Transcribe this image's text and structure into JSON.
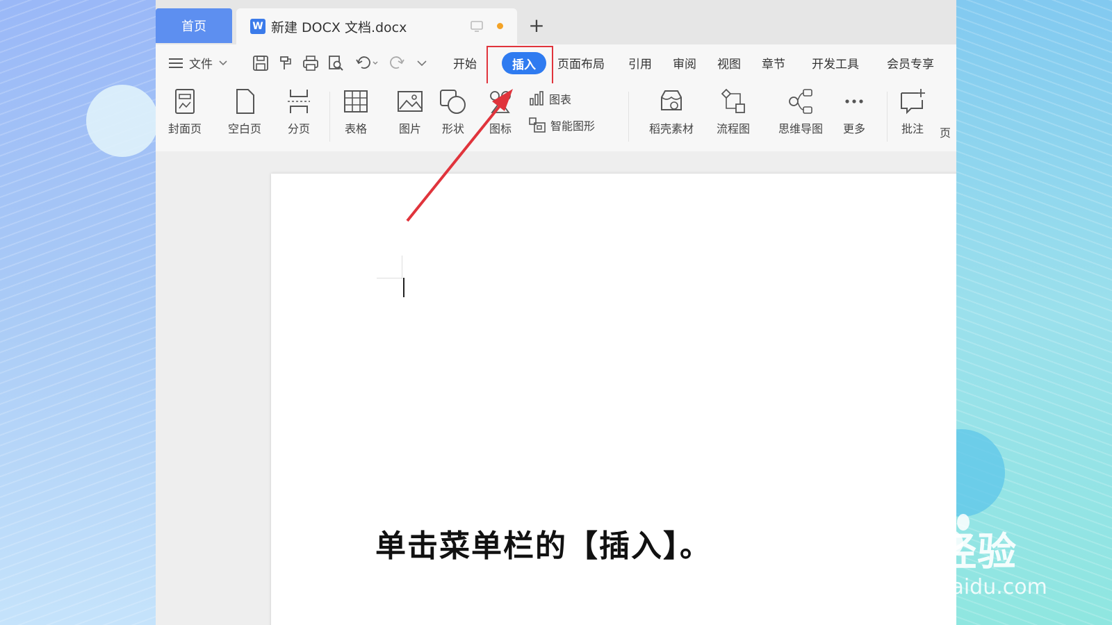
{
  "tabs": {
    "home_label": "首页",
    "doc_icon_letter": "W",
    "doc_title": "新建 DOCX 文档.docx",
    "add_symbol": "+"
  },
  "menubar": {
    "file_label": "文件",
    "tabs": [
      "开始",
      "插入",
      "页面布局",
      "引用",
      "审阅",
      "视图",
      "章节",
      "开发工具",
      "会员专享"
    ],
    "active_tab": "插入"
  },
  "ribbon": {
    "items": [
      {
        "label": "封面页",
        "icon": "cover-page-icon"
      },
      {
        "label": "空白页",
        "icon": "blank-page-icon"
      },
      {
        "label": "分页",
        "icon": "page-break-icon"
      },
      {
        "label": "表格",
        "icon": "table-icon"
      },
      {
        "label": "图片",
        "icon": "picture-icon"
      },
      {
        "label": "形状",
        "icon": "shapes-icon"
      },
      {
        "label": "图标",
        "icon": "icons-icon"
      },
      {
        "label": "图表",
        "icon": "chart-icon"
      },
      {
        "label": "智能图形",
        "icon": "smart-art-icon"
      },
      {
        "label": "稻壳素材",
        "icon": "docer-assets-icon"
      },
      {
        "label": "流程图",
        "icon": "flowchart-icon"
      },
      {
        "label": "思维导图",
        "icon": "mindmap-icon"
      },
      {
        "label": "更多",
        "icon": "more-icon"
      },
      {
        "label": "批注",
        "icon": "comment-icon"
      },
      {
        "label": "页",
        "icon": "page-icon"
      }
    ]
  },
  "caption": "单击菜单栏的【插入】。",
  "watermark": {
    "logo_text": "Bai  经验",
    "url": "jingyan.baidu.com"
  },
  "colors": {
    "accent": "#2f7bf0",
    "highlight": "#e0343c",
    "home_tab": "#5d8ff0",
    "unsaved_dot": "#f3a327"
  }
}
